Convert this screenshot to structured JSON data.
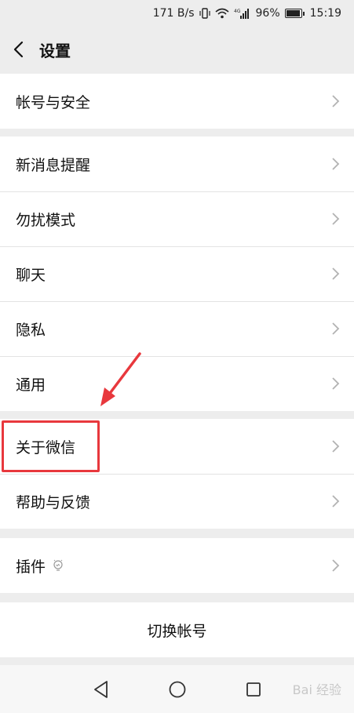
{
  "status_bar": {
    "network_speed": "171 B/s",
    "signal_label": "4G",
    "battery_level": "96%",
    "battery_fraction": 0.96,
    "time": "15:19"
  },
  "nav": {
    "title": "设置",
    "back_icon": "chevron-left-icon"
  },
  "sections": {
    "account": [
      "帐号与安全"
    ],
    "main": [
      "新消息提醒",
      "勿扰模式",
      "聊天",
      "隐私",
      "通用"
    ],
    "about": [
      "关于微信",
      "帮助与反馈"
    ],
    "plugins": [
      "插件"
    ],
    "switch": "切换帐号"
  },
  "annotation": {
    "highlight_color": "#e8383d"
  },
  "bottom_nav": {
    "back": "triangle-back-icon",
    "home": "circle-home-icon",
    "recent": "square-recent-icon"
  },
  "watermark": "Bai 经验"
}
